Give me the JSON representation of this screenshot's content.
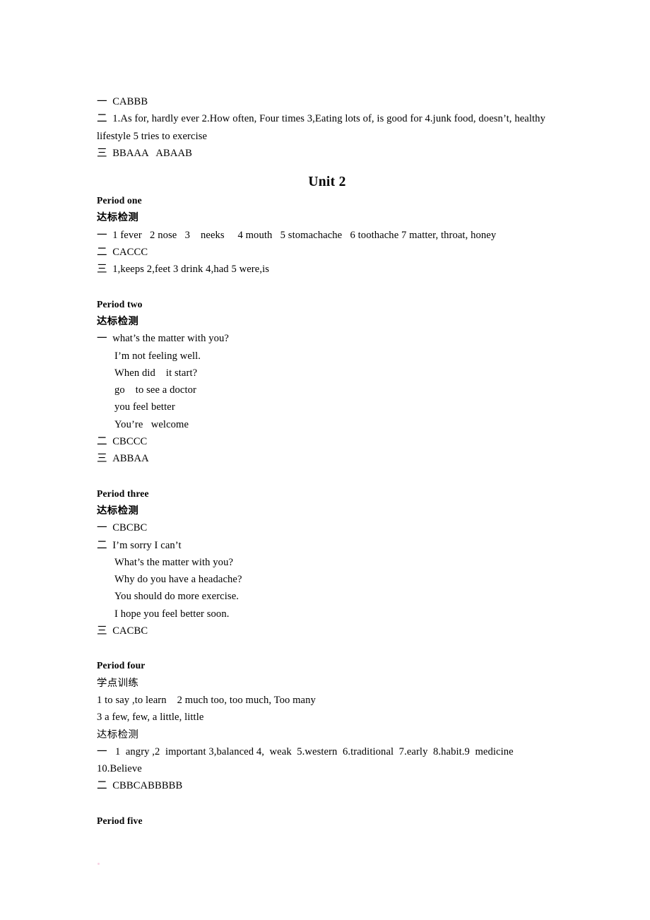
{
  "document": {
    "unit_title": "Unit 2",
    "headings": {
      "dabiao_jiance": "达标检测",
      "xuedian_xunlian": "学点训练"
    },
    "markers": {
      "one": "一",
      "two": "二",
      "three": "三"
    }
  },
  "prev_section": {
    "line_1": "一  CABBB",
    "line_2": "二  1.As for, hardly ever 2.How often, Four times 3,Eating lots of, is good for 4.junk food, doesn’t,",
    "line_2_wrap": "healthy lifestyle 5 tries to exercise",
    "line_3": "三  BBAAA   ABAAB"
  },
  "periods": [
    {
      "title": "Period one",
      "subheading": "达标检测",
      "subheading_bold": true,
      "lines": [
        "一  1 fever   2 nose   3    neeks     4 mouth   5 stomachache   6 toothache 7 matter, throat, honey",
        "二  CACCC",
        "三  1,keeps 2,feet 3 drink 4,had 5 were,is"
      ]
    },
    {
      "title": "Period two",
      "subheading": "达标检测",
      "subheading_bold": true,
      "lines": [
        "一  what’s the matter with you?"
      ],
      "indented_lines": [
        "I’m not feeling well.",
        "When did    it start?",
        "go    to see a doctor",
        "you feel better",
        "You’re   welcome"
      ],
      "trailing_lines": [
        "二  CBCCC",
        "三  ABBAA"
      ]
    },
    {
      "title": "Period three",
      "subheading": "达标检测",
      "subheading_bold": true,
      "lines": [
        "一  CBCBC",
        "二  I’m sorry I can’t"
      ],
      "indented_lines": [
        "What’s the matter with you?",
        "Why do you have a headache?",
        "You should do more exercise.",
        "I hope you feel better soon."
      ],
      "trailing_lines": [
        "三  CACBC"
      ]
    },
    {
      "title": "Period four",
      "subheading": "学点训练",
      "subheading_bold": false,
      "lines": [
        "1 to say ,to learn    2 much too, too much, Too many",
        "3 a few, few, a little, little"
      ],
      "subheading_2": "达标检测",
      "subheading_2_bold": false,
      "trailing_lines": [
        "一   1  angry ,2  important 3,balanced 4,  weak  5.western  6.traditional  7.early  8.habit.9  medicine",
        "10.Believe",
        "二  CBBCABBBBB"
      ]
    },
    {
      "title": "Period five",
      "subheading": "",
      "lines": []
    }
  ]
}
